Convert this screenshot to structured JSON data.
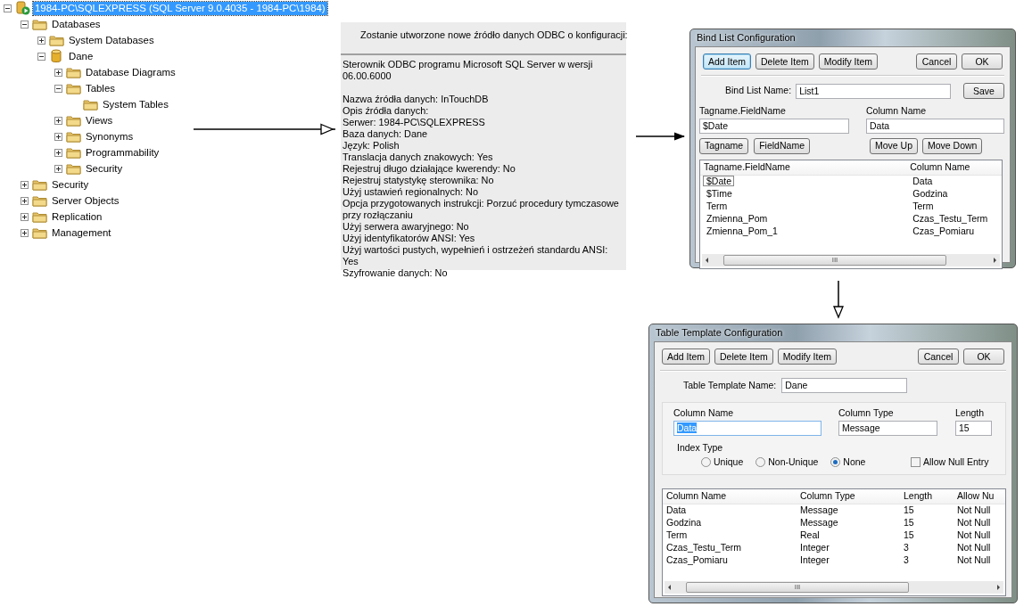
{
  "tree": [
    {
      "label": "1984-PC\\SQLEXPRESS (SQL Server 9.0.4035 - 1984-PC\\1984)",
      "kind": "server",
      "expanded": true,
      "selected": true,
      "children": [
        {
          "label": "Databases",
          "kind": "folder",
          "expanded": true,
          "selected": false,
          "children": [
            {
              "label": "System Databases",
              "kind": "folder",
              "expanded": false,
              "selected": false
            },
            {
              "label": "Dane",
              "kind": "database",
              "expanded": true,
              "selected": false,
              "children": [
                {
                  "label": "Database Diagrams",
                  "kind": "folder",
                  "expanded": false,
                  "selected": false
                },
                {
                  "label": "Tables",
                  "kind": "folder",
                  "expanded": true,
                  "selected": false,
                  "children": [
                    {
                      "label": "System Tables",
                      "kind": "folder",
                      "selected": false
                    }
                  ]
                },
                {
                  "label": "Views",
                  "kind": "folder",
                  "expanded": false,
                  "selected": false
                },
                {
                  "label": "Synonyms",
                  "kind": "folder",
                  "expanded": false,
                  "selected": false
                },
                {
                  "label": "Programmability",
                  "kind": "folder",
                  "expanded": false,
                  "selected": false
                },
                {
                  "label": "Security",
                  "kind": "folder",
                  "expanded": false,
                  "selected": false
                }
              ]
            }
          ]
        },
        {
          "label": "Security",
          "kind": "folder",
          "expanded": false,
          "selected": false
        },
        {
          "label": "Server Objects",
          "kind": "folder",
          "expanded": false,
          "selected": false
        },
        {
          "label": "Replication",
          "kind": "folder",
          "expanded": false,
          "selected": false
        },
        {
          "label": "Management",
          "kind": "folder",
          "expanded": false,
          "selected": false
        }
      ]
    }
  ],
  "odbc_summary": {
    "heading": "Zostanie utworzone nowe źródło danych ODBC o konfiguracji:",
    "driver": "Sterownik ODBC programu Microsoft SQL Server w wersji 06.00.6000",
    "lines": [
      "Nazwa źródła danych: InTouchDB",
      "Opis źródła danych:",
      "Serwer: 1984-PC\\SQLEXPRESS",
      "Baza danych: Dane",
      "Język: Polish",
      "Translacja danych znakowych: Yes",
      "Rejestruj długo działające kwerendy: No",
      "Rejestruj statystykę sterownika: No",
      "Użyj ustawień regionalnych: No",
      "Opcja przygotowanych instrukcji: Porzuć procedury tymczasowe przy rozłączaniu",
      "Użyj serwera awaryjnego: No",
      "Użyj identyfikatorów ANSI: Yes",
      "Użyj wartości pustych, wypełnień i ostrzeżeń standardu ANSI: Yes",
      "Szyfrowanie danych: No"
    ]
  },
  "bind_list": {
    "title": "Bind List Configuration",
    "left_buttons": [
      {
        "label": "Add Item",
        "focused": true
      },
      {
        "label": "Delete Item",
        "focused": false
      },
      {
        "label": "Modify Item",
        "focused": false
      }
    ],
    "right_buttons": [
      {
        "label": "Cancel",
        "focused": false
      },
      {
        "label": "OK",
        "focused": false
      }
    ],
    "name_label": "Bind List Name:",
    "name_value": "List1",
    "save_button": "Save",
    "tag_label": "Tagname.FieldName",
    "tag_value": "$Date",
    "column_label": "Column Name",
    "column_value": "Data",
    "tag_buttons": [
      "Tagname",
      "FieldName"
    ],
    "move_buttons": [
      "Move Up",
      "Move Down"
    ],
    "columns": [
      "Tagname.FieldName",
      "Column Name"
    ],
    "rows": [
      {
        "cells": [
          "$Date",
          "Data"
        ],
        "selected": true
      },
      {
        "cells": [
          "$Time",
          "Godzina"
        ],
        "selected": false
      },
      {
        "cells": [
          "Term",
          "Term"
        ],
        "selected": false
      },
      {
        "cells": [
          "Zmienna_Pom",
          "Czas_Testu_Term"
        ],
        "selected": false
      },
      {
        "cells": [
          "Zmienna_Pom_1",
          "Czas_Pomiaru"
        ],
        "selected": false
      }
    ],
    "scroll_grip": "III"
  },
  "table_template": {
    "title": "Table Template Configuration",
    "left_buttons": [
      {
        "label": "Add Item",
        "focused": false
      },
      {
        "label": "Delete Item",
        "focused": false
      },
      {
        "label": "Modify Item",
        "focused": false
      }
    ],
    "right_buttons": [
      {
        "label": "Cancel",
        "focused": false
      },
      {
        "label": "OK",
        "focused": false
      }
    ],
    "name_label": "Table Template Name:",
    "name_value": "Dane",
    "column_name": {
      "label": "Column Name",
      "value": "Data",
      "text_selected": true
    },
    "column_type": {
      "label": "Column Type",
      "value": "Message"
    },
    "length": {
      "label": "Length",
      "value": "15"
    },
    "index_type": {
      "label": "Index Type",
      "options": [
        {
          "label": "Unique",
          "selected": false
        },
        {
          "label": "Non-Unique",
          "selected": false
        },
        {
          "label": "None",
          "selected": true
        }
      ]
    },
    "allow_null": {
      "label": "Allow Null Entry",
      "checked": false
    },
    "columns": [
      "Column Name",
      "Column Type",
      "Length",
      "Allow Nu"
    ],
    "rows": [
      [
        "Data",
        "Message",
        "15",
        "Not Null"
      ],
      [
        "Godzina",
        "Message",
        "15",
        "Not Null"
      ],
      [
        "Term",
        "Real",
        "15",
        "Not Null"
      ],
      [
        "Czas_Testu_Term",
        "Integer",
        "3",
        "Not Null"
      ],
      [
        "Czas_Pomiaru",
        "Integer",
        "3",
        "Not Null"
      ]
    ],
    "scroll_grip": "III"
  }
}
